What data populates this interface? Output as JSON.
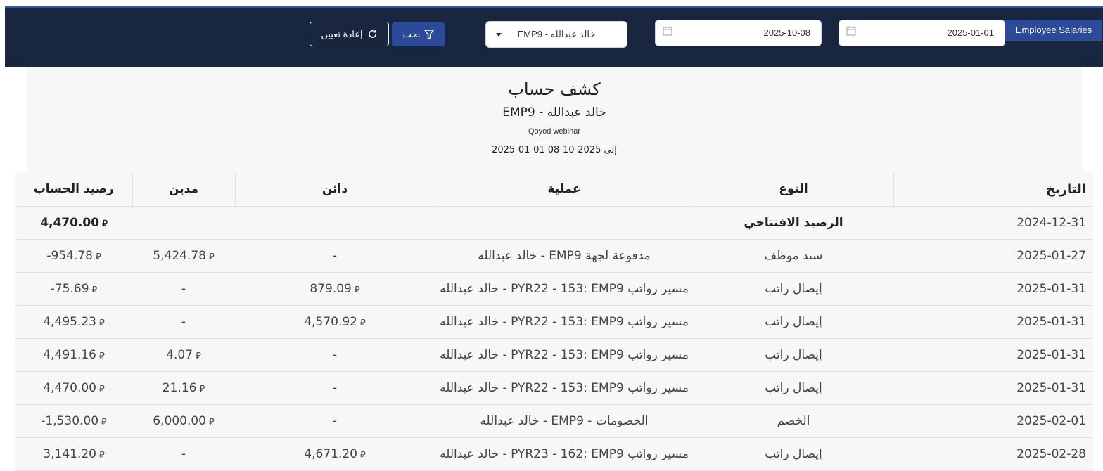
{
  "filters": {
    "report_button": "Employee Salaries",
    "from_date": "2025-01-01",
    "to_date": "2025-10-08",
    "employee": "EMP9 - خالد عبدالله",
    "search_label": "بحث",
    "reset_label": "إعادة تعيين"
  },
  "report": {
    "title": "كشف حساب",
    "subtitle": "EMP9 - خالد عبدالله",
    "company": "Qoyod webinar",
    "period": "2025-01-01 إلى 2025-10-08"
  },
  "table": {
    "headers": {
      "date": "التاريخ",
      "type": "النوع",
      "operation": "عملية",
      "credit": "دائن",
      "debit": "مدين",
      "balance": "رصيد الحساب"
    },
    "currency_symbol": "⃁",
    "opening": {
      "date": "2024-12-31",
      "label": "الرصيد الافتتاحي",
      "balance": "4,470.00"
    },
    "rows": [
      {
        "date": "2025-01-27",
        "type": "سند موظف",
        "operation": "مدفوعة لجهة EMP9 - خالد عبدالله",
        "credit": "-",
        "debit": "5,424.78",
        "balance": "-954.78"
      },
      {
        "date": "2025-01-31",
        "type": "إيصال راتب",
        "operation": "مسير رواتب PYR22 - 153: EMP9 - خالد عبدالله",
        "credit": "879.09",
        "debit": "-",
        "balance": "-75.69"
      },
      {
        "date": "2025-01-31",
        "type": "إيصال راتب",
        "operation": "مسير رواتب PYR22 - 153: EMP9 - خالد عبدالله",
        "credit": "4,570.92",
        "debit": "-",
        "balance": "4,495.23"
      },
      {
        "date": "2025-01-31",
        "type": "إيصال راتب",
        "operation": "مسير رواتب PYR22 - 153: EMP9 - خالد عبدالله",
        "credit": "-",
        "debit": "4.07",
        "balance": "4,491.16"
      },
      {
        "date": "2025-01-31",
        "type": "إيصال راتب",
        "operation": "مسير رواتب PYR22 - 153: EMP9 - خالد عبدالله",
        "credit": "-",
        "debit": "21.16",
        "balance": "4,470.00"
      },
      {
        "date": "2025-02-01",
        "type": "الخصم",
        "operation": "الخصومات - EMP9 - خالد عبدالله",
        "credit": "-",
        "debit": "6,000.00",
        "balance": "-1,530.00"
      },
      {
        "date": "2025-02-28",
        "type": "إيصال راتب",
        "operation": "مسير رواتب PYR23 - 162: EMP9 - خالد عبدالله",
        "credit": "4,671.20",
        "debit": "-",
        "balance": "3,141.20"
      }
    ]
  }
}
